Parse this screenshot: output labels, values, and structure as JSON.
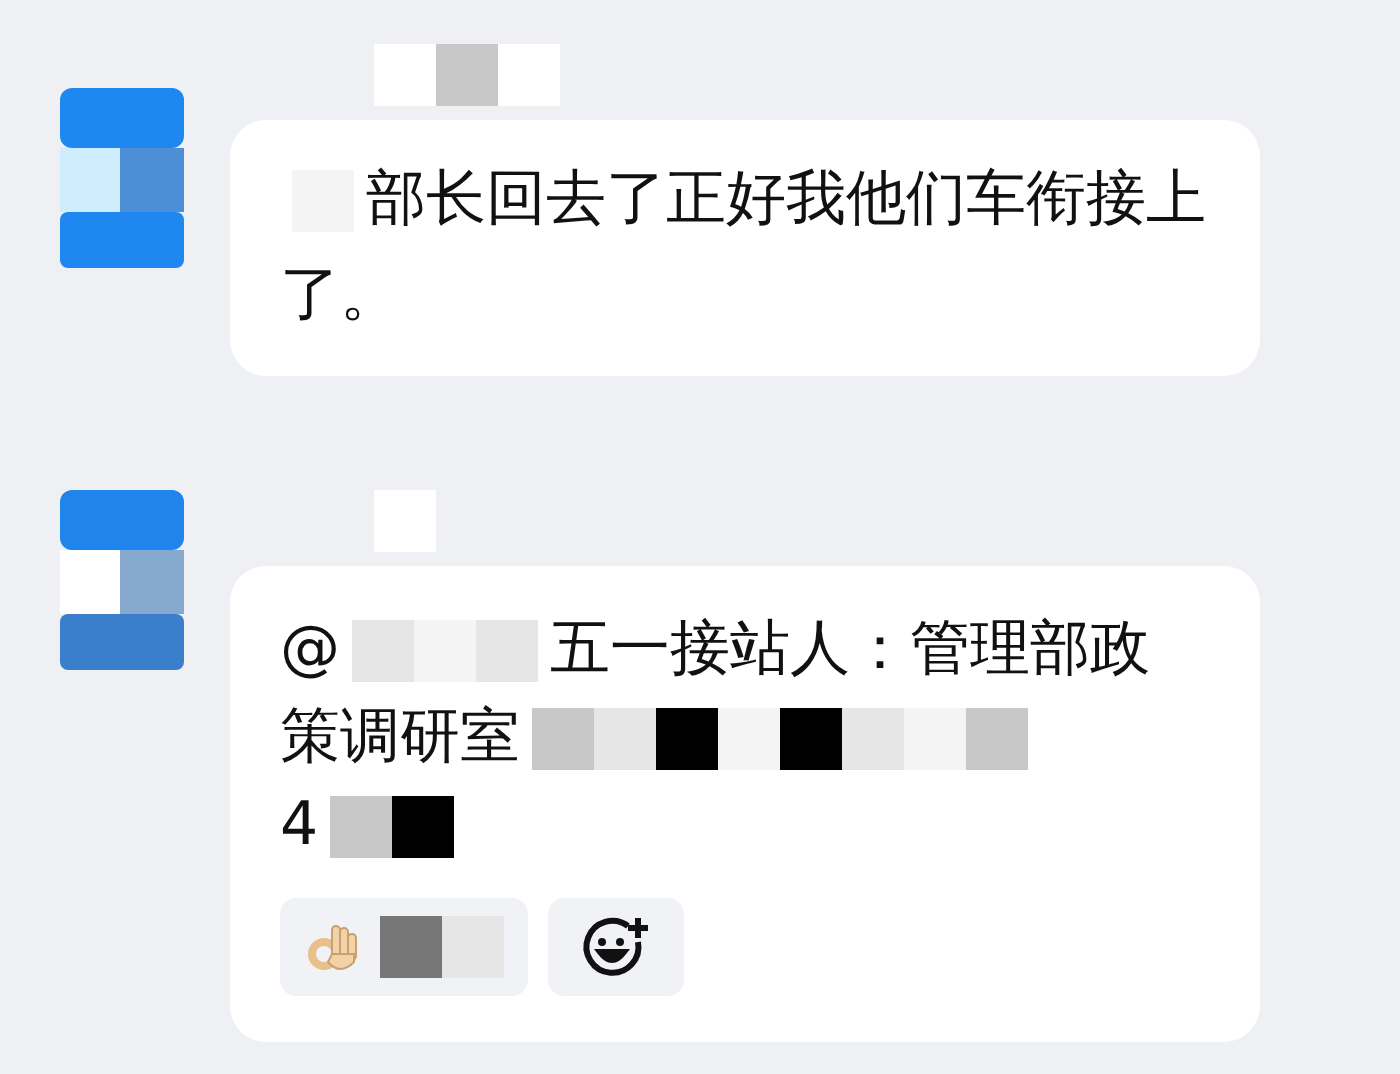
{
  "messages": [
    {
      "sender": [
        {
          "kind": "white"
        },
        {
          "kind": "grey"
        },
        {
          "kind": "white"
        }
      ],
      "lines": [
        [
          {
            "kind": "mosaic",
            "tiles": [
              {
                "kind": "white"
              }
            ]
          },
          {
            "kind": "text",
            "text": "部长回去了正好我他们车衔接上"
          }
        ],
        [
          {
            "kind": "text",
            "text": "了。"
          }
        ]
      ]
    },
    {
      "sender": [
        {
          "kind": "white"
        }
      ],
      "lines": [
        [
          {
            "kind": "text",
            "text": "@"
          },
          {
            "kind": "mosaic",
            "tiles": [
              {
                "kind": "light"
              },
              {
                "kind": "white"
              },
              {
                "kind": "light"
              }
            ]
          },
          {
            "kind": "text",
            "text": "五一接站人：管理部政"
          }
        ],
        [
          {
            "kind": "text",
            "text": "策调研室"
          },
          {
            "kind": "mosaic",
            "tiles": [
              {
                "kind": "grey"
              },
              {
                "kind": "light"
              },
              {
                "kind": "black"
              },
              {
                "kind": "white"
              },
              {
                "kind": "black"
              },
              {
                "kind": "light"
              },
              {
                "kind": "white"
              },
              {
                "kind": "grey"
              }
            ]
          }
        ],
        [
          {
            "kind": "text",
            "text": "4"
          },
          {
            "kind": "mosaic",
            "tiles": [
              {
                "kind": "grey"
              },
              {
                "kind": "black"
              }
            ]
          }
        ]
      ],
      "reactions": [
        {
          "kind": "ok",
          "name": [
            {
              "kind": "dark"
            },
            {
              "kind": "light"
            }
          ]
        },
        {
          "kind": "add"
        }
      ]
    }
  ]
}
